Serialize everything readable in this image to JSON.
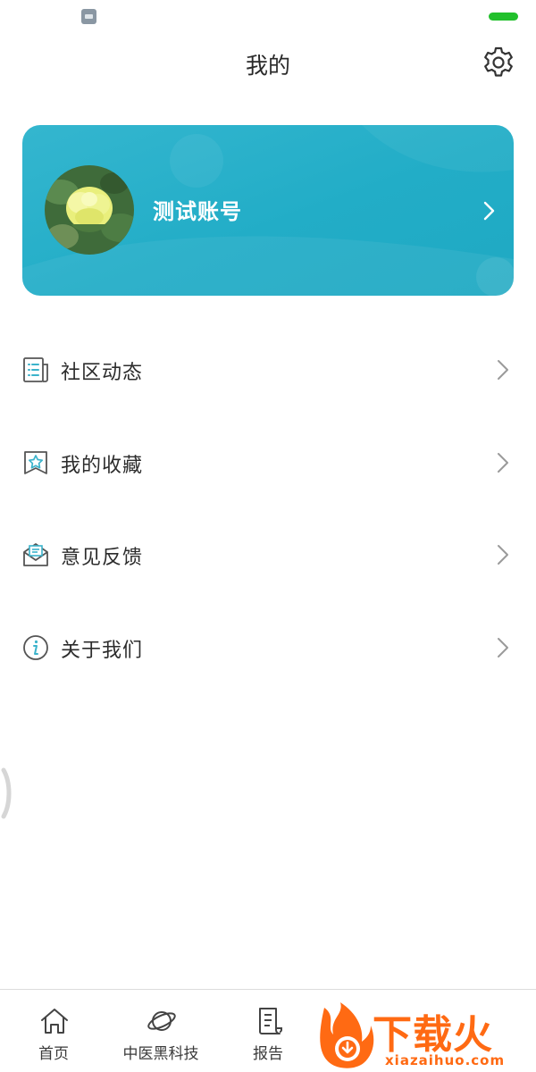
{
  "header": {
    "title": "我的",
    "settings_icon": "gear-icon"
  },
  "profile": {
    "username": "测试账号",
    "avatar_icon": "flower-avatar",
    "chevron_icon": "chevron-right-icon",
    "accent_color": "#26b0c9"
  },
  "menu": {
    "items": [
      {
        "label": "社区动态",
        "icon": "news-list-icon"
      },
      {
        "label": "我的收藏",
        "icon": "bookmark-star-icon"
      },
      {
        "label": "意见反馈",
        "icon": "mail-open-icon"
      },
      {
        "label": "关于我们",
        "icon": "info-circle-icon"
      }
    ]
  },
  "tabbar": {
    "tabs": [
      {
        "label": "首页",
        "icon": "home-icon"
      },
      {
        "label": "中医黑科技",
        "icon": "planet-icon"
      },
      {
        "label": "报告",
        "icon": "document-icon"
      }
    ]
  },
  "watermark": {
    "main": "下载火",
    "sub": "xiazaihuo.com",
    "color": "#ff6a13"
  }
}
